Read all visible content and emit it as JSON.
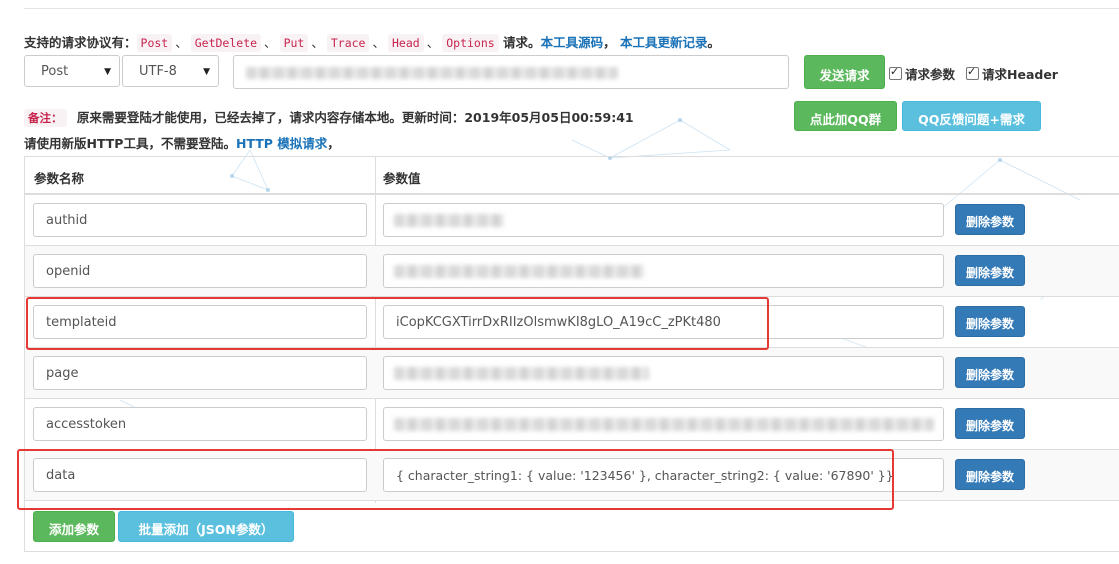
{
  "header": {
    "supported_label": "支持的请求协议有：",
    "protocols": [
      "Post",
      "GetDelete",
      "Put",
      "Trace",
      "Head",
      "Options"
    ],
    "protocol_separator": "、",
    "protocols_suffix": "请求。",
    "source_link": "本工具源码",
    "comma": "，",
    "changelog_link": "本工具更新记录",
    "period": "。"
  },
  "controls": {
    "method": "Post",
    "encoding": "UTF-8",
    "url_value": "",
    "send_button": "发送请求",
    "check_params_label": "请求参数",
    "check_header_label": "请求Header",
    "join_qq_button": "点此加QQ群",
    "feedback_button": "QQ反馈问题+需求"
  },
  "notice": {
    "tag": "备注：",
    "text": "原来需要登陆才能使用，已经去掉了，请求内容存储本地。更新时间：2019年05月05日00:59:41"
  },
  "hint": {
    "text": "请使用新版HTTP工具，不需要登陆。",
    "link": "HTTP 模拟请求",
    "suffix": "，"
  },
  "table": {
    "col_name": "参数名称",
    "col_value": "参数值",
    "delete_label": "删除参数",
    "rows": [
      {
        "name": "authid",
        "value": ""
      },
      {
        "name": "openid",
        "value": ""
      },
      {
        "name": "templateid",
        "value": "iCopKCGXTirrDxRIIzOlsmwKI8gLO_A19cC_zPKt480"
      },
      {
        "name": "page",
        "value": ""
      },
      {
        "name": "accesstoken",
        "value": ""
      },
      {
        "name": "data",
        "value": "{ character_string1: { value: '123456' }, character_string2: { value: '67890' }}"
      }
    ]
  },
  "footer": {
    "add_button": "添加参数",
    "batch_add_button": "批量添加（JSON参数）"
  },
  "colors": {
    "green": "#5cb85c",
    "cyan": "#5bc0de",
    "blue": "#337ab7",
    "highlight_red": "#e53935",
    "code_red": "#c7254e",
    "link_blue": "#1a73b8"
  }
}
